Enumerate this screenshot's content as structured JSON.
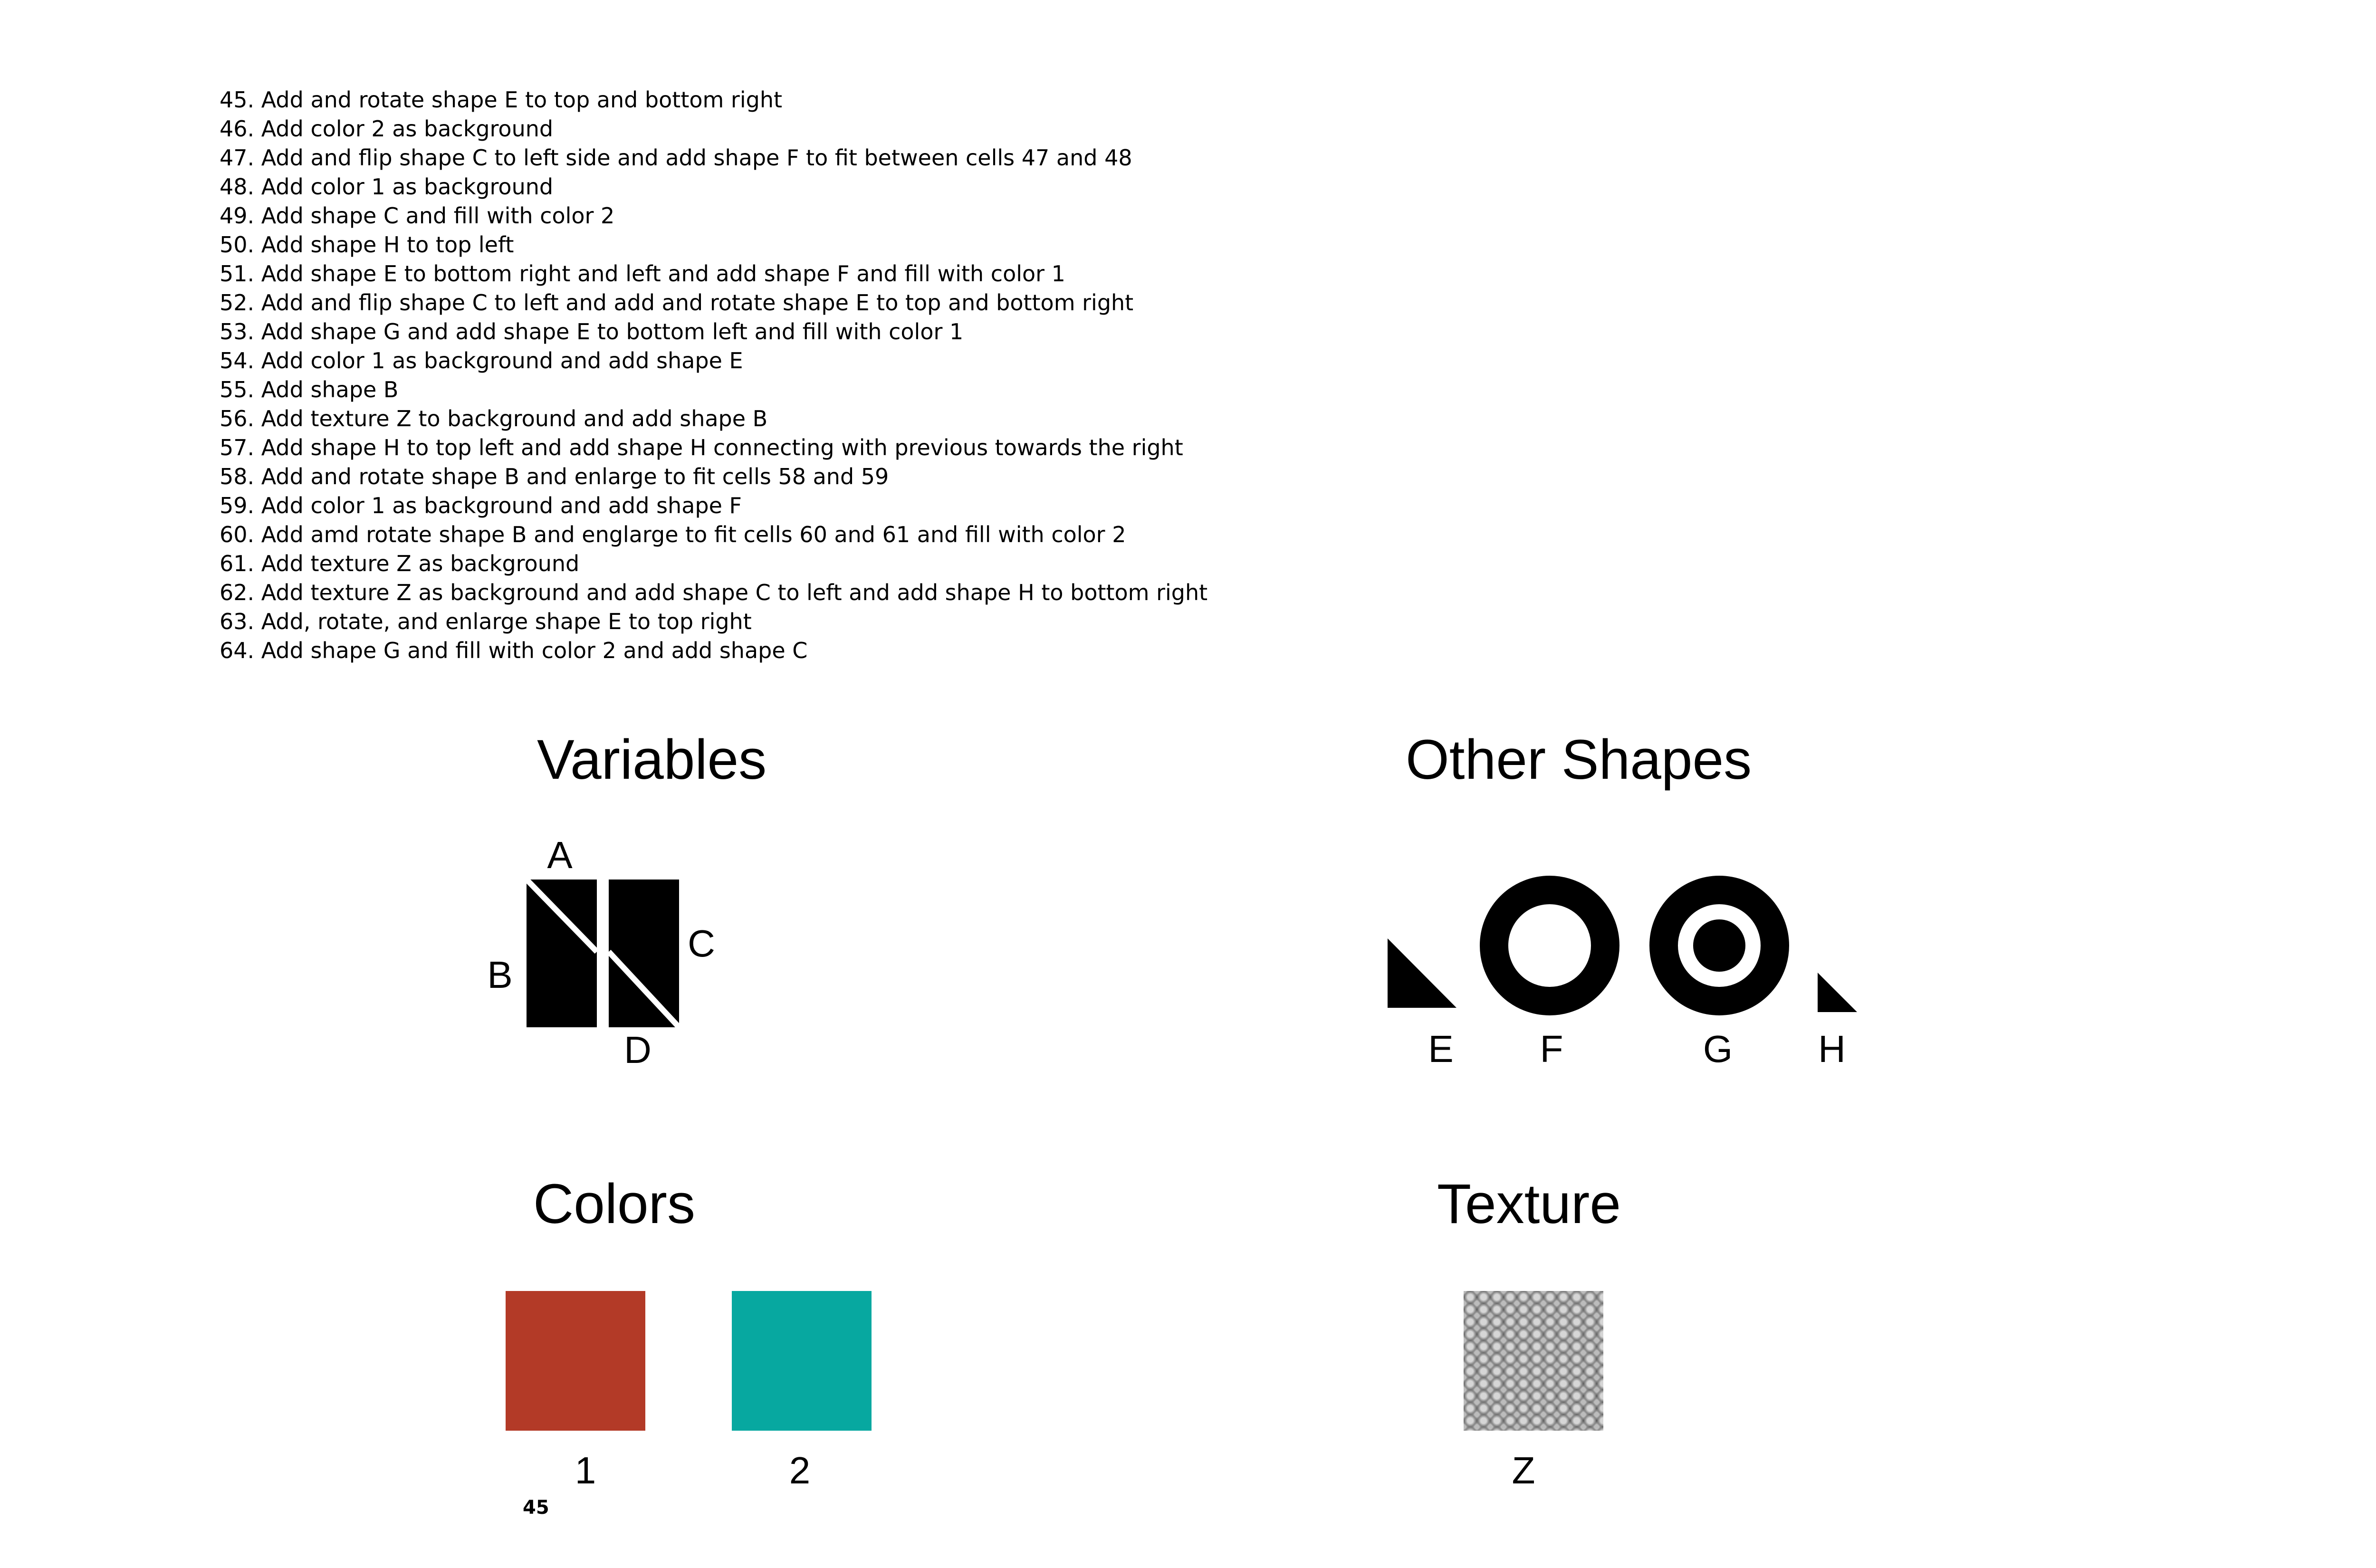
{
  "instructions": [
    "45. Add and rotate shape E to top and bottom right",
    "46. Add color 2 as background",
    "47. Add and flip shape C to left side and add shape F to fit between cells 47 and 48",
    "48. Add color 1 as background",
    "49. Add shape C and fill with color 2",
    "50. Add shape H to top left",
    "51. Add shape E to bottom right and left and add shape F and fill with color 1",
    "52. Add and flip shape C to left and add and rotate shape E to top and bottom right",
    "53. Add shape G and add shape E to bottom left and fill with color 1",
    "54. Add color 1 as background and add shape E",
    "55. Add shape B",
    "56. Add texture Z to background and add shape B",
    "57. Add shape H to top left and add shape H connecting with previous towards the right",
    "58. Add and rotate shape B and enlarge to fit cells 58 and 59",
    "59. Add color 1 as background and add shape F",
    "60. Add amd rotate shape B and englarge to fit cells 60 and 61 and fill with color 2",
    "61. Add texture Z as background",
    "62. Add texture Z as background and add shape C to left and add shape H to bottom right",
    "63. Add, rotate, and enlarge shape E to top right",
    "64. Add shape G and fill with color 2 and add shape C"
  ],
  "variables": {
    "heading": "Variables",
    "labels": {
      "a": "A",
      "b": "B",
      "c": "C",
      "d": "D"
    }
  },
  "other_shapes": {
    "heading": "Other Shapes",
    "labels": {
      "e": "E",
      "f": "F",
      "g": "G",
      "h": "H"
    }
  },
  "colors": {
    "heading": "Colors",
    "swatches": [
      {
        "label": "1",
        "hex": "#b33a27"
      },
      {
        "label": "2",
        "hex": "#07a8a0"
      }
    ]
  },
  "texture": {
    "heading": "Texture",
    "label": "Z"
  },
  "page_number": "45"
}
